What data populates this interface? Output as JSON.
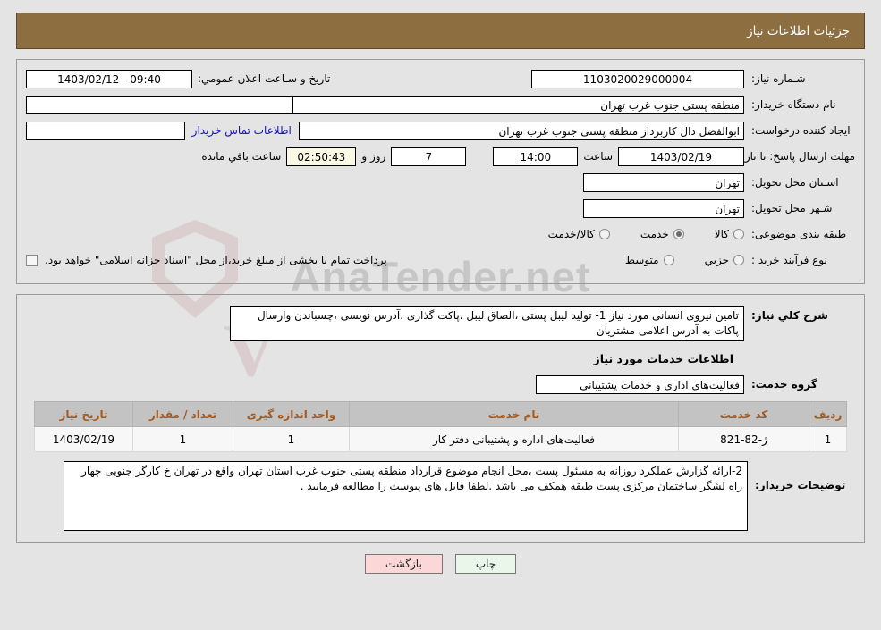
{
  "header": {
    "title": "جزئیات اطلاعات نیاز"
  },
  "form": {
    "need_number": {
      "label": "شـماره نیاز:",
      "value": "1103020029000004"
    },
    "buyer_org": {
      "label": "نام دستگاه خریدار:",
      "value": "منطقه پستی جنوب غرب تهران"
    },
    "creator": {
      "label": "ایجاد کننده درخواست:",
      "value": "ابوالفضل  دال  کاربرداز منطقه پستی جنوب غرب تهران"
    },
    "deadline": {
      "label": "مهلت ارسال پاسخ: تا تاریخ:",
      "date": "1403/02/19",
      "time_label": "ساعت",
      "time": "14:00",
      "days": "7",
      "days_label": "روز و",
      "countdown": "02:50:43",
      "remaining_label": "ساعت باقي مانده"
    },
    "province": {
      "label": "اسـتان محل تحویل:",
      "value": "تهران"
    },
    "city": {
      "label": "شـهر محل تحویل:",
      "value": "تهران"
    },
    "announce": {
      "label": "تاریخ و سـاعت اعلان عمومي:",
      "value": "09:40 - 1403/02/12"
    },
    "contact_link": "اطلاعات تماس خریدار",
    "category": {
      "label": "طبقه بندی موضوعی:",
      "options": [
        {
          "label": "کالا",
          "selected": false
        },
        {
          "label": "خدمت",
          "selected": true
        },
        {
          "label": "کالا/خدمت",
          "selected": false
        }
      ]
    },
    "process": {
      "label": "نوع فرآیند خرید :",
      "options": [
        {
          "label": "جزيي",
          "selected": false
        },
        {
          "label": "متوسط",
          "selected": false
        }
      ],
      "checkbox_label": "پرداخت تمام یا بخشی از مبلغ خرید،از محل \"اسناد خزانه اسلامی\" خواهد بود.",
      "checkbox_checked": false
    }
  },
  "description": {
    "label": "شرح کلي نیاز:",
    "value": "تامین نیروی انسانی مورد نیاز 1- تولید لیبل پستی ،الصاق لیبل ،پاکت گذاری ،آدرس نویسی ،چسباندن وارسال پاکات به آدرس اعلامی مشتریان"
  },
  "services_section": {
    "title": "اطلاعات خدمات مورد نیاز",
    "group": {
      "label": "گروه خدمت:",
      "value": "فعالیت‌های اداری و خدمات پشتیبانی"
    },
    "table": {
      "columns": [
        "ردیف",
        "کد خدمت",
        "نام خدمت",
        "واحد اندازه گیری",
        "تعداد / مقدار",
        "تاریخ نیاز"
      ],
      "rows": [
        [
          "1",
          "ژ-82-821",
          "فعالیت‌های اداره و پشتیبانی دفتر کار",
          "1",
          "1",
          "1403/02/19"
        ]
      ]
    }
  },
  "buyer_notes": {
    "label": "توضیحات خریدار:",
    "value": "2-ارائه گزارش عملکرد روزانه به مسئول پست ،محل انجام موضوع قرارداد منطقه پستی جنوب غرب استان تهران واقع در تهران خ کارگر جنوبی چهار راه لشگر ساختمان مرکزی پست طبقه همکف می باشد .لطفا فایل های پیوست را مطالعه فرمایید ."
  },
  "buttons": {
    "print": "چاپ",
    "back": "بازگشت"
  },
  "watermark": {
    "text": "AnaTender.net"
  },
  "colors": {
    "header_bg": "#8d6e41",
    "table_header_bg": "#c3c3c3",
    "table_header_text": "#a8581b",
    "link": "#1212cc",
    "print_btn": "#e9f6e9",
    "back_btn": "#fbd7d7"
  }
}
